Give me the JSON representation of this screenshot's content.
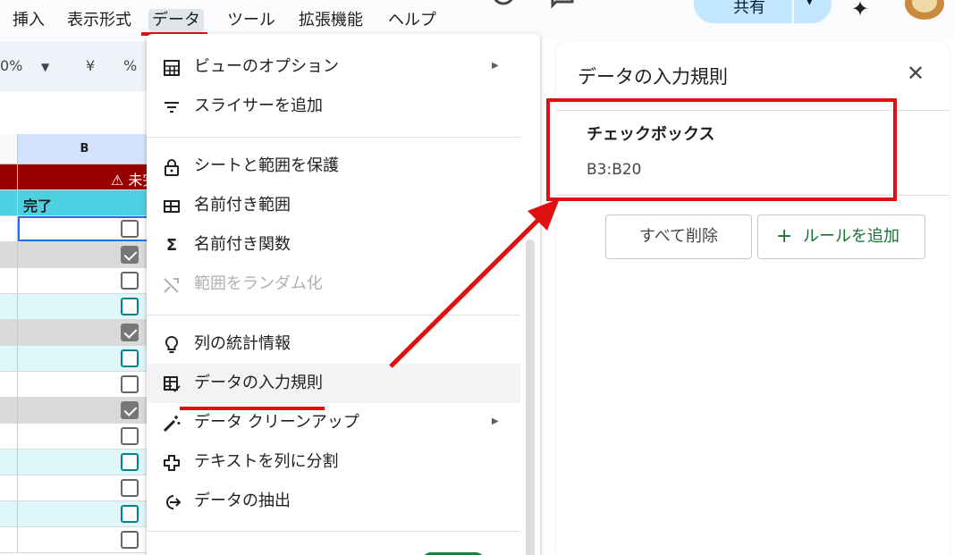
{
  "menubar": {
    "items": [
      "挿入",
      "表示形式",
      "データ",
      "ツール",
      "拡張機能",
      "ヘルプ"
    ],
    "active": "データ"
  },
  "header": {
    "share_label": "共有"
  },
  "toolbar": {
    "zoom": "0%",
    "yen": "¥",
    "percent": "%"
  },
  "grid": {
    "column_b": "B",
    "banner_text": "⚠ 未完",
    "header_text": "完了",
    "checkboxes": [
      {
        "checked": false,
        "style": "gray"
      },
      {
        "checked": true,
        "style": "gray"
      },
      {
        "checked": false,
        "style": "gray"
      },
      {
        "checked": false,
        "style": "teal"
      },
      {
        "checked": true,
        "style": "gray"
      },
      {
        "checked": false,
        "style": "teal"
      },
      {
        "checked": false,
        "style": "gray"
      },
      {
        "checked": true,
        "style": "gray"
      },
      {
        "checked": false,
        "style": "gray"
      },
      {
        "checked": false,
        "style": "teal"
      },
      {
        "checked": false,
        "style": "gray"
      },
      {
        "checked": false,
        "style": "teal"
      },
      {
        "checked": false,
        "style": "gray"
      }
    ]
  },
  "menu": {
    "items": [
      {
        "label": "ビューのオプション",
        "icon": "grid-view-icon",
        "submenu": true
      },
      {
        "label": "スライサーを追加",
        "icon": "filter-lines-icon"
      },
      {
        "label": "シートと範囲を保護",
        "icon": "lock-icon"
      },
      {
        "label": "名前付き範囲",
        "icon": "table-icon"
      },
      {
        "label": "名前付き関数",
        "icon": "sigma-icon"
      },
      {
        "label": "範囲をランダム化",
        "icon": "shuffle-icon",
        "disabled": true
      },
      {
        "label": "列の統計情報",
        "icon": "lightbulb-icon"
      },
      {
        "label": "データの入力規則",
        "icon": "validation-icon"
      },
      {
        "label": "データ クリーンアップ",
        "icon": "magic-wand-icon",
        "submenu": true
      },
      {
        "label": "テキストを列に分割",
        "icon": "split-icon"
      },
      {
        "label": "データの抽出",
        "icon": "extract-icon"
      }
    ]
  },
  "panel": {
    "title": "データの入力規則",
    "rule_type": "チェックボックス",
    "rule_range": "B3:B20",
    "delete_all_label": "すべて削除",
    "add_rule_label": "ルールを追加"
  },
  "colors": {
    "annotation_red": "#e01010",
    "banner": "#980000",
    "header_teal": "#4dd0e1"
  }
}
